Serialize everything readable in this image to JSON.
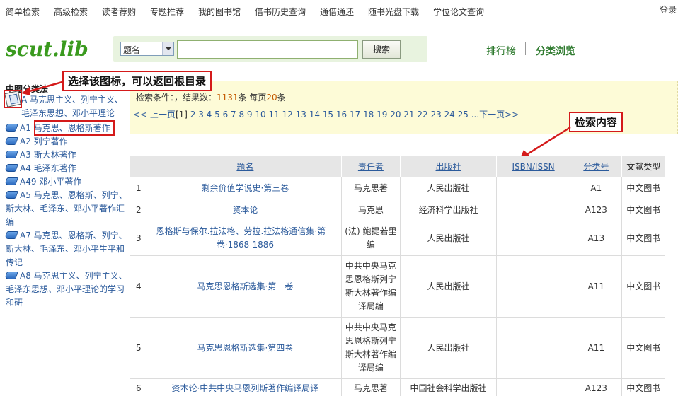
{
  "topnav": {
    "items": [
      "简单检索",
      "高级检索",
      "读者荐购",
      "专题推荐",
      "我的图书馆",
      "借书历史查询",
      "通借通还",
      "随书光盘下载",
      "学位论文查询"
    ],
    "login": "登录"
  },
  "logo": "scut.lib",
  "search": {
    "field_value": "题名",
    "input_value": "",
    "button_label": "搜索"
  },
  "right_links": {
    "ranking": "排行榜",
    "classify": "分类浏览"
  },
  "sidebar": {
    "title": "中图分类法",
    "root_text": "A 马克思主义、列宁主义、毛泽东思想、邓小平理论",
    "items": [
      {
        "code": "A1",
        "label": "马克思、恩格斯著作"
      },
      {
        "code": "A2",
        "label": "列宁著作"
      },
      {
        "code": "A3",
        "label": "斯大林著作"
      },
      {
        "code": "A4",
        "label": "毛泽东著作"
      },
      {
        "code": "A49",
        "label": "邓小平著作"
      },
      {
        "code": "A5",
        "label": "马克思、恩格斯、列宁、斯大林、毛泽东、邓小平著作汇编"
      },
      {
        "code": "A7",
        "label": "马克思、恩格斯、列宁、斯大林、毛泽东、邓小平生平和传记"
      },
      {
        "code": "A8",
        "label": "马克思主义、列宁主义、毛泽东思想、邓小平理论的学习和研"
      }
    ]
  },
  "callouts": {
    "root_tip": "选择该图标，可以返回根目录",
    "content_tip": "检索内容"
  },
  "notice": {
    "info_prefix": "检索条件：，结果数：",
    "result_count": "1131",
    "info_mid": "条 每页",
    "per_page": "20",
    "info_suffix": "条",
    "pager_prev": "<< 上一页",
    "pager_current": "[1]",
    "pager_pages": "2 3 4 5 6 7 8 9 10 11 12 13 14 15 16 17 18 19 20 21 22 23 24 25",
    "pager_next": "...下一页>>"
  },
  "table": {
    "headers": [
      "题名",
      "责任者",
      "出版社",
      "ISBN/ISSN",
      "分类号",
      "文献类型"
    ],
    "rows": [
      {
        "idx": "1",
        "title": "剩余价值学说史·第三卷",
        "author": "马克思著",
        "publisher": "人民出版社",
        "isbn": "",
        "class": "A1",
        "type": "中文图书"
      },
      {
        "idx": "2",
        "title": "资本论",
        "author": "马克思",
        "publisher": "经济科学出版社",
        "isbn": "",
        "class": "A123",
        "type": "中文图书"
      },
      {
        "idx": "3",
        "title": "恩格斯与保尔.拉法格、劳拉.拉法格通信集·第一卷·1868-1886",
        "author": "(法) 鲍提若里编",
        "publisher": "人民出版社",
        "isbn": "",
        "class": "A13",
        "type": "中文图书"
      },
      {
        "idx": "4",
        "title": "马克思恩格斯选集·第一卷",
        "author": "中共中央马克思恩格斯列宁斯大林著作编译局编",
        "publisher": "人民出版社",
        "isbn": "",
        "class": "A11",
        "type": "中文图书"
      },
      {
        "idx": "5",
        "title": "马克思恩格斯选集·第四卷",
        "author": "中共中央马克思恩格斯列宁斯大林著作编译局编",
        "publisher": "人民出版社",
        "isbn": "",
        "class": "A11",
        "type": "中文图书"
      },
      {
        "idx": "6",
        "title": "资本论·中共中央马恩列斯著作编译局译",
        "author": "马克思著",
        "publisher": "中国社会科学出版社",
        "isbn": "",
        "class": "A123",
        "type": "中文图书"
      }
    ]
  },
  "colors": {
    "accent_green": "#3a9a1e",
    "link_blue": "#2b5a9b",
    "callout_red": "#d41a1a",
    "notice_bg": "#fdfbd7"
  }
}
